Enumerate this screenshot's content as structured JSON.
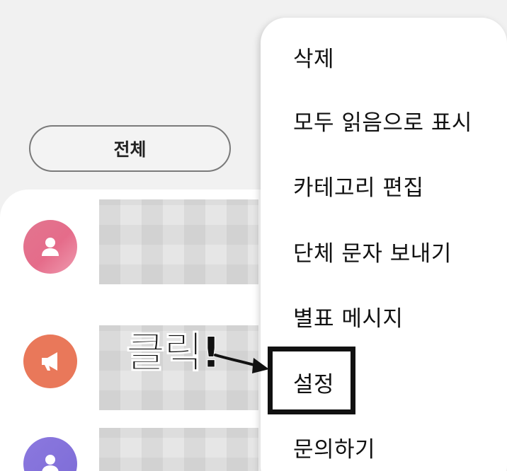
{
  "filter_chip": {
    "label": "전체"
  },
  "menu": {
    "items": [
      {
        "label": "삭제"
      },
      {
        "label": "모두 읽음으로 표시"
      },
      {
        "label": "카테고리 편집"
      },
      {
        "label": "단체 문자 보내기"
      },
      {
        "label": "별표 메시지"
      },
      {
        "label": "설정"
      },
      {
        "label": "문의하기"
      }
    ]
  },
  "annotation": {
    "text": "클릭!"
  },
  "icons": {
    "avatar_1": "person-icon",
    "avatar_2": "megaphone-icon",
    "avatar_3": "person-icon"
  },
  "colors": {
    "avatar_1": "#e56c8a",
    "avatar_2": "#e9785a",
    "avatar_3": "#7d6cd6"
  }
}
